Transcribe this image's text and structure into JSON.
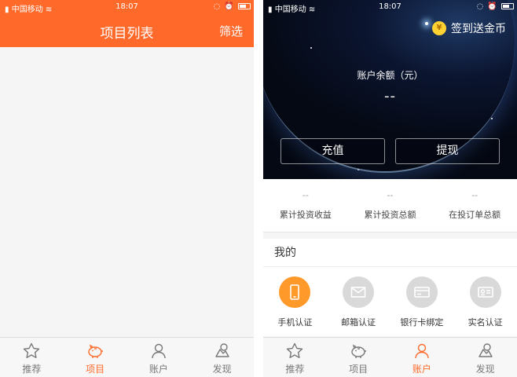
{
  "colors": {
    "accent": "#ff6a2b",
    "phone_icon_bg": "#ff9a2a",
    "inactive": "#777777"
  },
  "status_bar": {
    "carrier": "中国移动",
    "time": "18:07"
  },
  "projects_screen": {
    "title": "项目列表",
    "filter_label": "筛选"
  },
  "account_screen": {
    "checkin_label": "签到送金币",
    "coin_glyph": "¥",
    "balance_label": "账户余额（元）",
    "balance_value": "--",
    "recharge_label": "充值",
    "withdraw_label": "提现",
    "stats": [
      {
        "value": "--",
        "label": "累计投资收益"
      },
      {
        "value": "--",
        "label": "累计投资总额"
      },
      {
        "value": "--",
        "label": "在投订单总额"
      }
    ],
    "mine_title": "我的",
    "mine_items": [
      {
        "label": "手机认证",
        "icon": "phone-icon"
      },
      {
        "label": "邮箱认证",
        "icon": "mail-icon"
      },
      {
        "label": "银行卡绑定",
        "icon": "bank-card-icon"
      },
      {
        "label": "实名认证",
        "icon": "id-card-icon"
      }
    ]
  },
  "tabs": [
    {
      "label": "推荐",
      "icon": "star-icon"
    },
    {
      "label": "项目",
      "icon": "piggy-bank-icon"
    },
    {
      "label": "账户",
      "icon": "user-icon"
    },
    {
      "label": "发现",
      "icon": "discover-icon"
    }
  ],
  "left_active_tab": "项目",
  "right_active_tab": "账户"
}
